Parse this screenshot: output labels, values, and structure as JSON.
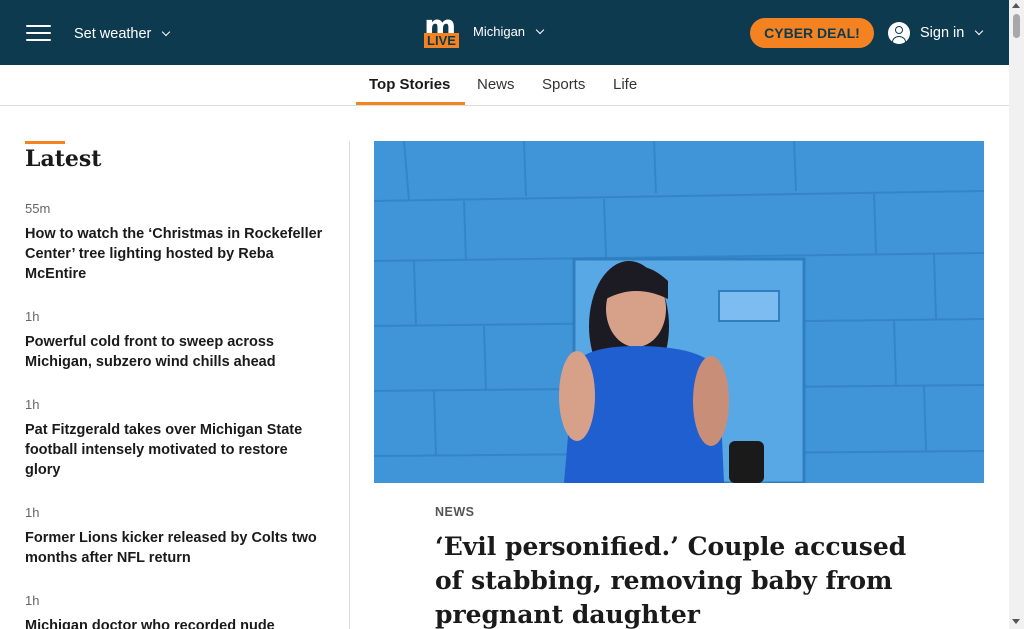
{
  "header": {
    "weather_label": "Set weather",
    "logo_top": "m",
    "logo_bottom": "LIVE",
    "region": "Michigan",
    "cyber_label": "CYBER DEAL!",
    "signin_label": "Sign in"
  },
  "nav": {
    "tabs": [
      {
        "label": "Top Stories",
        "active": true
      },
      {
        "label": "News"
      },
      {
        "label": "Sports"
      },
      {
        "label": "Life"
      }
    ]
  },
  "sidebar": {
    "title": "Latest",
    "items": [
      {
        "time": "55m",
        "headline": "How to watch the ‘Christmas in Rockefeller Center’ tree lighting hosted by Reba McEntire"
      },
      {
        "time": "1h",
        "headline": "Powerful cold front to sweep across Michigan, subzero wind chills ahead"
      },
      {
        "time": "1h",
        "headline": "Pat Fitzgerald takes over Michigan State football intensely motivated to restore glory"
      },
      {
        "time": "1h",
        "headline": "Former Lions kicker released by Colts two months after NFL return"
      },
      {
        "time": "1h",
        "headline": "Michigan doctor who recorded nude"
      }
    ]
  },
  "main": {
    "kicker": "NEWS",
    "headline": "‘Evil personified.’ Couple accused of stabbing, removing baby from pregnant daughter"
  },
  "colors": {
    "header_bg": "#0e3a4f",
    "accent": "#f58220",
    "photo_bg": "#3d92d7"
  }
}
